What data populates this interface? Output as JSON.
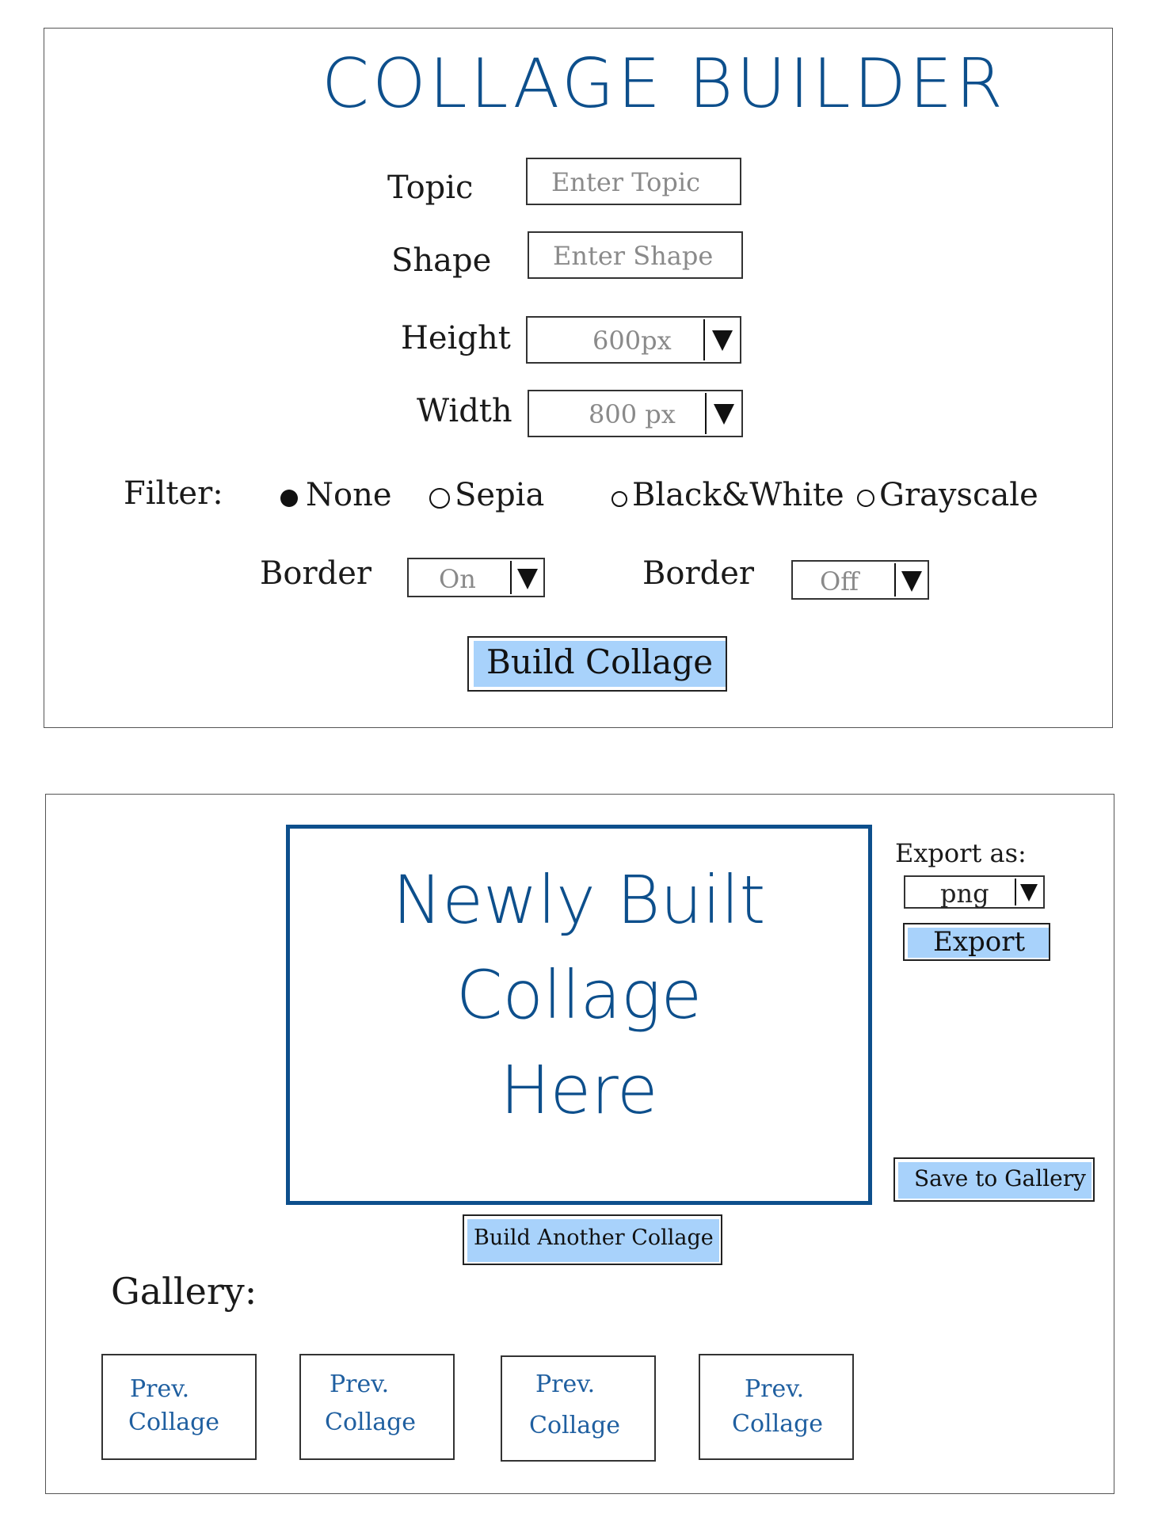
{
  "app": {
    "title": "COLLAGE BUILDER"
  },
  "form": {
    "topic": {
      "label": "Topic",
      "placeholder": "Enter Topic"
    },
    "shape": {
      "label": "Shape",
      "placeholder": "Enter Shape"
    },
    "height": {
      "label": "Height",
      "value": "600px"
    },
    "width": {
      "label": "Width",
      "value": "800 px"
    },
    "filter": {
      "label": "Filter:",
      "options": [
        {
          "label": "None",
          "selected": true
        },
        {
          "label": "Sepia",
          "selected": false
        },
        {
          "label": "Black&White",
          "selected": false
        },
        {
          "label": "Grayscale",
          "selected": false
        }
      ]
    },
    "border_on": {
      "label": "Border",
      "value": "On"
    },
    "border_off": {
      "label": "Border",
      "value": "Off"
    },
    "build_button": "Build Collage"
  },
  "result": {
    "preview_lines": [
      "Newly Built",
      "Collage",
      "Here"
    ],
    "export_label": "Export as:",
    "export_format": "png",
    "export_button": "Export",
    "save_button": "Save to Gallery",
    "build_another_button": "Build Another Collage"
  },
  "gallery": {
    "label": "Gallery:",
    "items": [
      {
        "line1": "Prev.",
        "line2": "Collage"
      },
      {
        "line1": "Prev.",
        "line2": "Collage"
      },
      {
        "line1": "Prev.",
        "line2": "Collage"
      },
      {
        "line1": "Prev.",
        "line2": "Collage"
      }
    ]
  },
  "colors": {
    "accent": "#0d4f8c",
    "highlight": "#a8d2fb",
    "ink": "#111111",
    "placeholder": "#8a8a8a"
  },
  "icons": {
    "dropdown": "triangle-down-icon"
  }
}
